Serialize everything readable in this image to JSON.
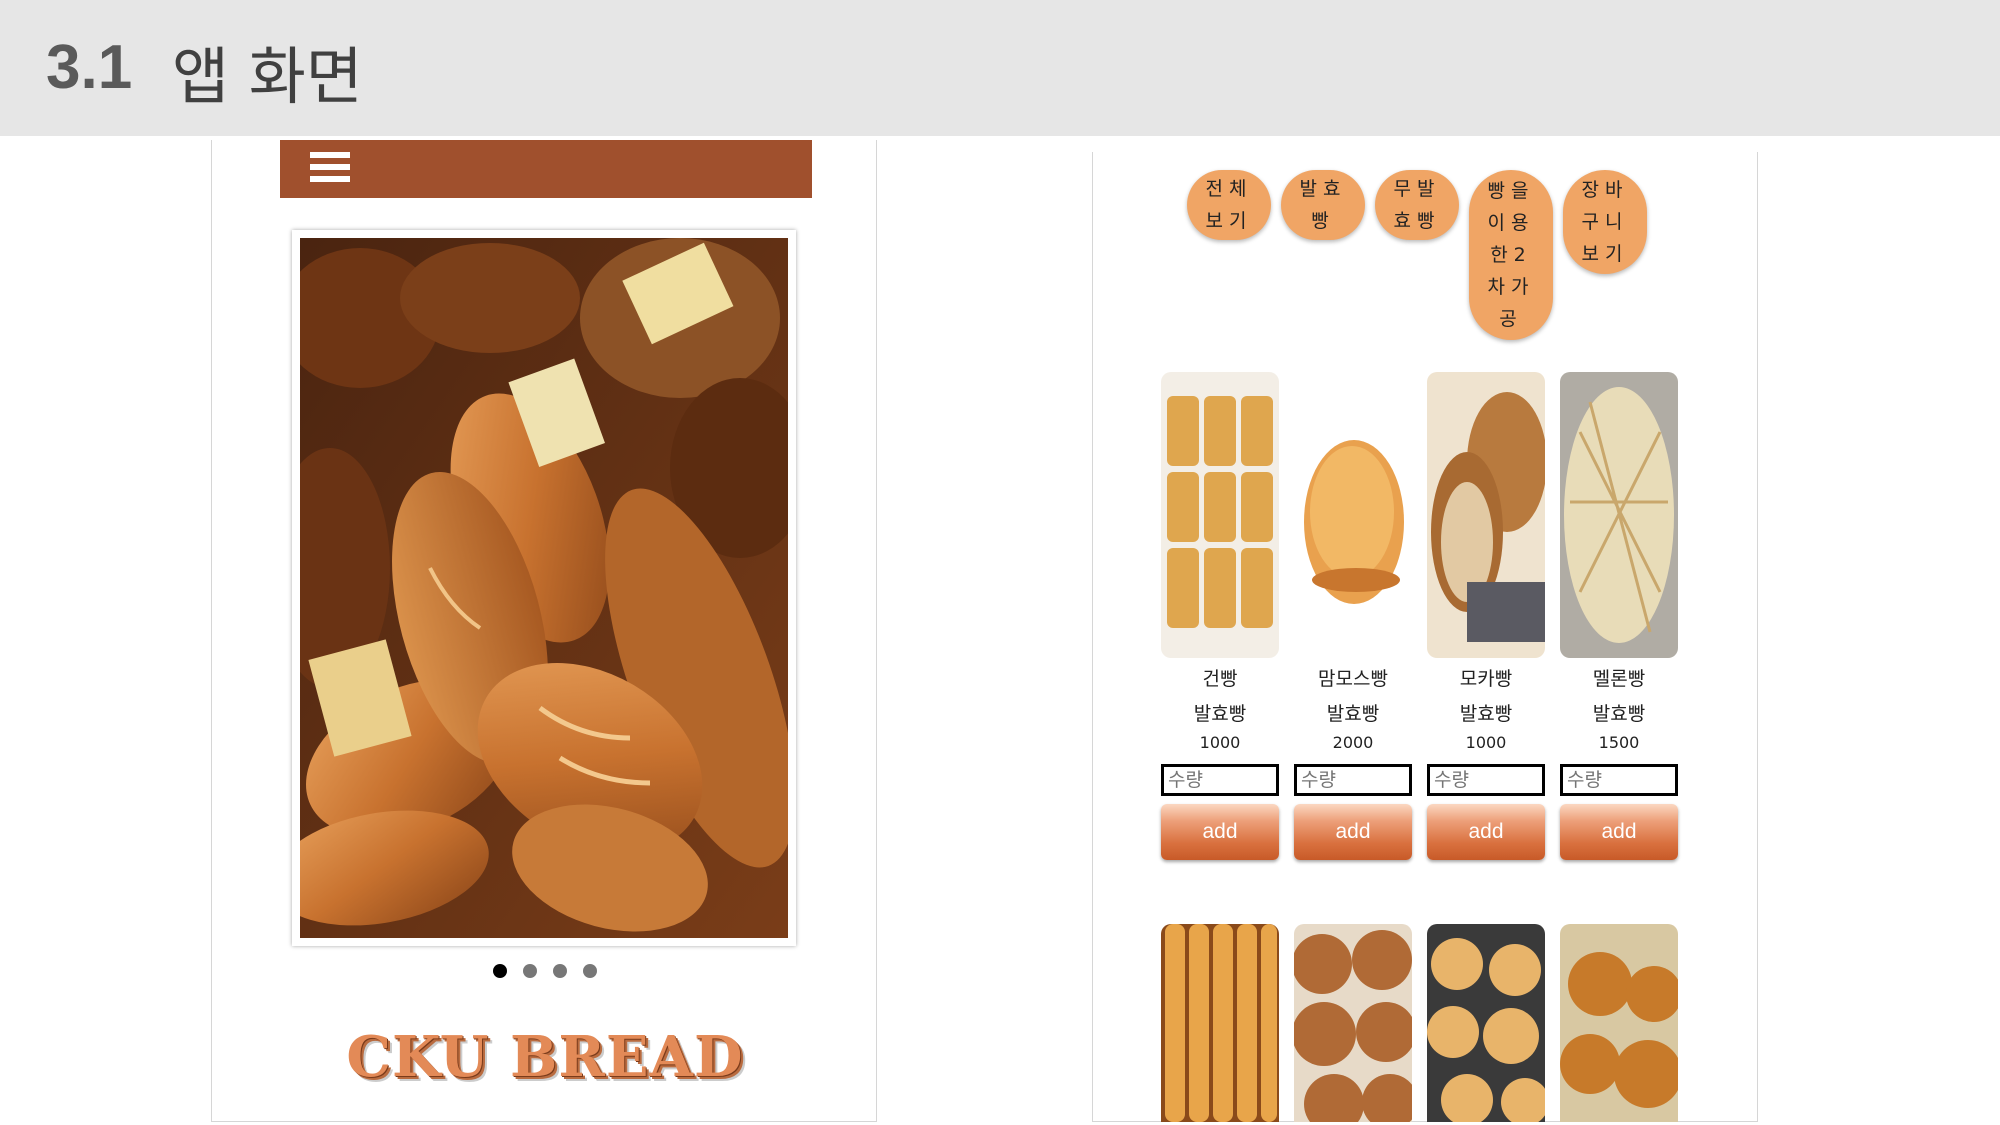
{
  "slide": {
    "number": "3.1",
    "title": "앱 화면"
  },
  "left_screen": {
    "menu_icon": "hamburger-menu-icon",
    "slide_dots": 4,
    "active_dot": 0,
    "brand": "CKU BREAD",
    "colors": {
      "navbar": "#a0502d",
      "brand": "#e38a57"
    }
  },
  "right_screen": {
    "categories": [
      {
        "label": "전체보기"
      },
      {
        "label": "발효빵"
      },
      {
        "label": "무발효빵"
      },
      {
        "label": "빵을이용한2차가공"
      },
      {
        "label": "장바구니보기"
      }
    ],
    "products": [
      {
        "name": "건빵",
        "category": "발효빵",
        "price": "1000",
        "qty_placeholder": "수량",
        "add_label": "add"
      },
      {
        "name": "맘모스빵",
        "category": "발효빵",
        "price": "2000",
        "qty_placeholder": "수량",
        "add_label": "add"
      },
      {
        "name": "모카빵",
        "category": "발효빵",
        "price": "1000",
        "qty_placeholder": "수량",
        "add_label": "add"
      },
      {
        "name": "멜론빵",
        "category": "발효빵",
        "price": "1500",
        "qty_placeholder": "수량",
        "add_label": "add"
      }
    ],
    "colors": {
      "category_button": "#f0a565",
      "add_button": "#d9713f"
    }
  }
}
